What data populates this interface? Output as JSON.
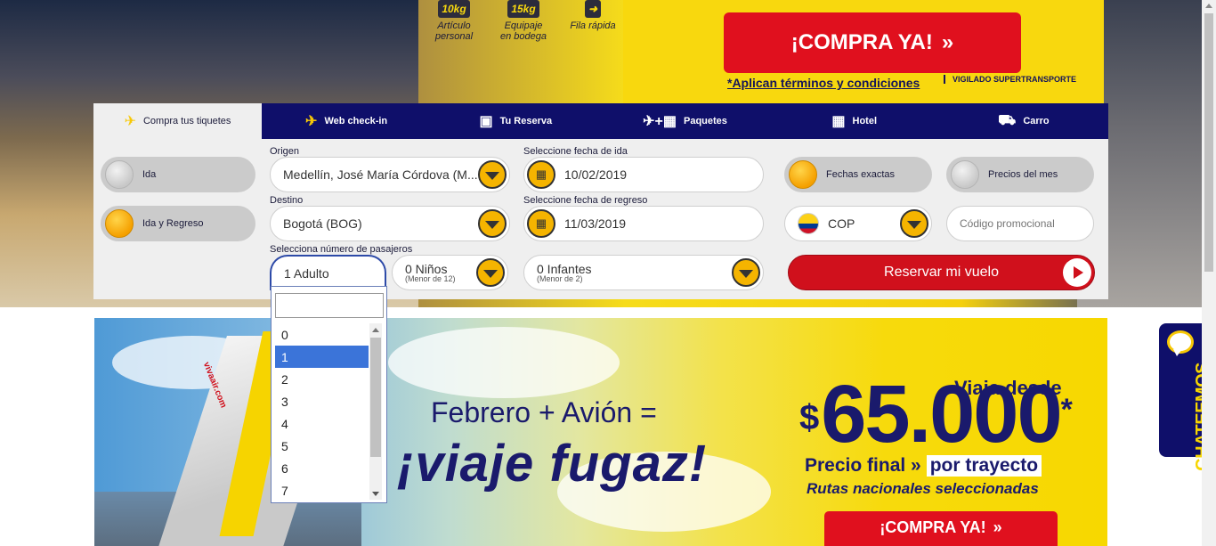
{
  "hero": {
    "baggage": [
      {
        "badge": "10kg",
        "label": "Artículo personal"
      },
      {
        "badge": "15kg",
        "label": "Equipaje en bodega"
      },
      {
        "badge": "",
        "label": "Fila rápida"
      }
    ],
    "buy_label": "¡COMPRA YA!",
    "buy_arrow": "»",
    "terms": "*Aplican términos y condiciones",
    "vigilado": "VIGILADO SUPERTRANSPORTE"
  },
  "tabs": [
    {
      "label": "Compra tus tiquetes",
      "icon": "plane-cloud-icon",
      "active": true
    },
    {
      "label": "Web check-in",
      "icon": "plane-cloud-icon"
    },
    {
      "label": "Tu Reserva",
      "icon": "reservation-icon"
    },
    {
      "label": "Paquetes",
      "icon": "plane-hotel-icon"
    },
    {
      "label": "Hotel",
      "icon": "building-icon"
    },
    {
      "label": "Carro",
      "icon": "car-icon"
    }
  ],
  "trip_type": {
    "one_way": "Ida",
    "round_trip": "Ida y Regreso",
    "selected": "round_trip"
  },
  "origin": {
    "label": "Origen",
    "value": "Medellín, José María Córdova (M..."
  },
  "destination": {
    "label": "Destino",
    "value": "Bogotá (BOG)"
  },
  "departure": {
    "label": "Seleccione fecha de ida",
    "value": "10/02/2019"
  },
  "return": {
    "label": "Seleccione fecha de regreso",
    "value": "11/03/2019"
  },
  "dates_mode": {
    "exact": "Fechas exactas",
    "monthly": "Precios del mes",
    "selected": "exact"
  },
  "currency": {
    "value": "COP"
  },
  "promo_code": {
    "placeholder": "Código promocional"
  },
  "passengers": {
    "label": "Selecciona número de pasajeros",
    "adults": "1 Adulto",
    "children": "0 Niños",
    "children_note": "(Menor de 12)",
    "infants": "0 Infantes",
    "infants_note": "(Menor de 2)"
  },
  "reserve_label": "Reservar mi vuelo",
  "adult_dropdown": {
    "search_value": "",
    "options": [
      "0",
      "1",
      "2",
      "3",
      "4",
      "5",
      "6",
      "7"
    ],
    "selected": "1"
  },
  "promo": {
    "line1": "Febrero + Avión =",
    "line2": "¡viaje fugaz!",
    "viaja_desde": "Viaja desde",
    "currency_symbol": "$",
    "price": "65.000",
    "asterisk": "*",
    "final_prefix": "Precio final »",
    "final_highlight": "por trayecto",
    "rutas": "Rutas nacionales seleccionadas",
    "buy_label": "¡COMPRA YA!",
    "buy_arrow": "»",
    "wing_brand": "vivaair.com"
  },
  "chat": {
    "label": "CHATEEMOS"
  },
  "colors": {
    "navy": "#0f0f6a",
    "yellow": "#f8d80e",
    "red": "#e0101e",
    "orange_button": "#f5b400"
  }
}
